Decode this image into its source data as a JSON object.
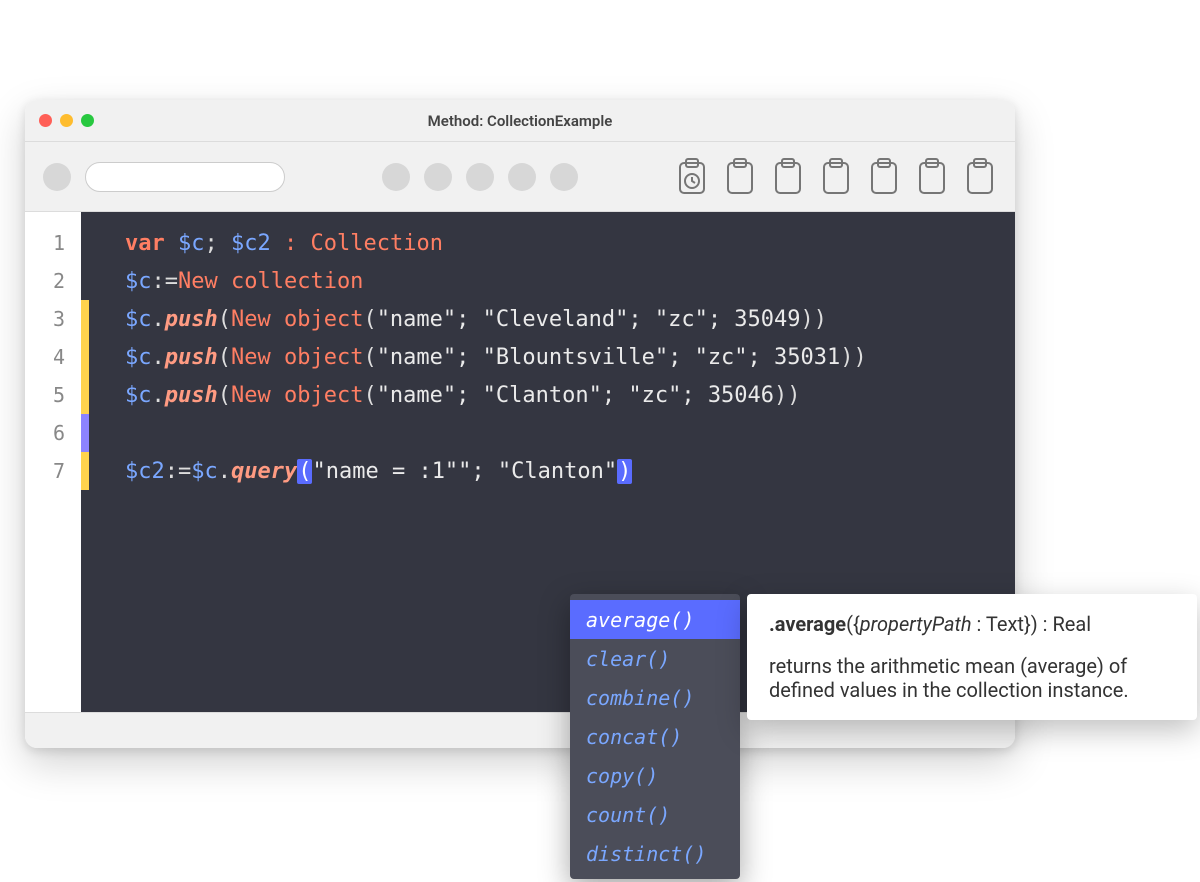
{
  "window": {
    "title": "Method: CollectionExample"
  },
  "gutter": {
    "lines": [
      "1",
      "2",
      "3",
      "4",
      "5",
      "6",
      "7"
    ]
  },
  "markers": [
    "",
    "",
    "yellow",
    "yellow",
    "yellow",
    "purple",
    "yellow"
  ],
  "code": {
    "lines": [
      {
        "tokens": [
          {
            "t": "var",
            "c": "tok-var"
          },
          {
            "t": " ",
            "c": ""
          },
          {
            "t": "$c",
            "c": "tok-varname"
          },
          {
            "t": "; ",
            "c": "tok-punct"
          },
          {
            "t": "$c2",
            "c": "tok-varname"
          },
          {
            "t": " ",
            "c": ""
          },
          {
            "t": ": Collection",
            "c": "tok-type"
          }
        ]
      },
      {
        "tokens": [
          {
            "t": "$c",
            "c": "tok-varname"
          },
          {
            "t": ":=",
            "c": "tok-punct"
          },
          {
            "t": "New collection",
            "c": "tok-func"
          }
        ]
      },
      {
        "tokens": [
          {
            "t": "$c",
            "c": "tok-varname"
          },
          {
            "t": ".",
            "c": "tok-punct"
          },
          {
            "t": "push",
            "c": "tok-method"
          },
          {
            "t": "(",
            "c": "tok-punct"
          },
          {
            "t": "New object",
            "c": "tok-func"
          },
          {
            "t": "(",
            "c": "tok-punct"
          },
          {
            "t": "\"name\"; \"Cleveland\"; \"zc\"; 35049",
            "c": "tok-str"
          },
          {
            "t": "))",
            "c": "tok-punct"
          }
        ]
      },
      {
        "tokens": [
          {
            "t": "$c",
            "c": "tok-varname"
          },
          {
            "t": ".",
            "c": "tok-punct"
          },
          {
            "t": "push",
            "c": "tok-method"
          },
          {
            "t": "(",
            "c": "tok-punct"
          },
          {
            "t": "New object",
            "c": "tok-func"
          },
          {
            "t": "(",
            "c": "tok-punct"
          },
          {
            "t": "\"name\"; \"Blountsville\"; \"zc\"; 35031",
            "c": "tok-str"
          },
          {
            "t": "))",
            "c": "tok-punct"
          }
        ]
      },
      {
        "tokens": [
          {
            "t": "$c",
            "c": "tok-varname"
          },
          {
            "t": ".",
            "c": "tok-punct"
          },
          {
            "t": "push",
            "c": "tok-method"
          },
          {
            "t": "(",
            "c": "tok-punct"
          },
          {
            "t": "New object",
            "c": "tok-func"
          },
          {
            "t": "(",
            "c": "tok-punct"
          },
          {
            "t": "\"name\"; \"Clanton\"; \"zc\"; 35046",
            "c": "tok-str"
          },
          {
            "t": "))",
            "c": "tok-punct"
          }
        ]
      },
      {
        "tokens": []
      },
      {
        "tokens": [
          {
            "t": "$c2",
            "c": "tok-varname"
          },
          {
            "t": ":=",
            "c": "tok-punct"
          },
          {
            "t": "$c",
            "c": "tok-varname"
          },
          {
            "t": ".",
            "c": "tok-punct"
          },
          {
            "t": "query",
            "c": "tok-method"
          },
          {
            "t": "(",
            "c": "tok-paren-hl"
          },
          {
            "t": "\"name = :1\"\"; \"Clanton\"",
            "c": "tok-str"
          },
          {
            "t": ")",
            "c": "tok-paren-hl"
          }
        ]
      }
    ]
  },
  "autocomplete": {
    "selectedIndex": 0,
    "items": [
      "average()",
      "clear()",
      "combine()",
      "concat()",
      "copy()",
      "count()",
      "distinct()"
    ]
  },
  "doc": {
    "signature_bold": ".average",
    "signature_rest_pre": "({",
    "signature_param": "propertyPath",
    "signature_rest_post": " : Text}) : Real",
    "description": "returns the arithmetic mean (average) of defined values in the collection instance."
  }
}
